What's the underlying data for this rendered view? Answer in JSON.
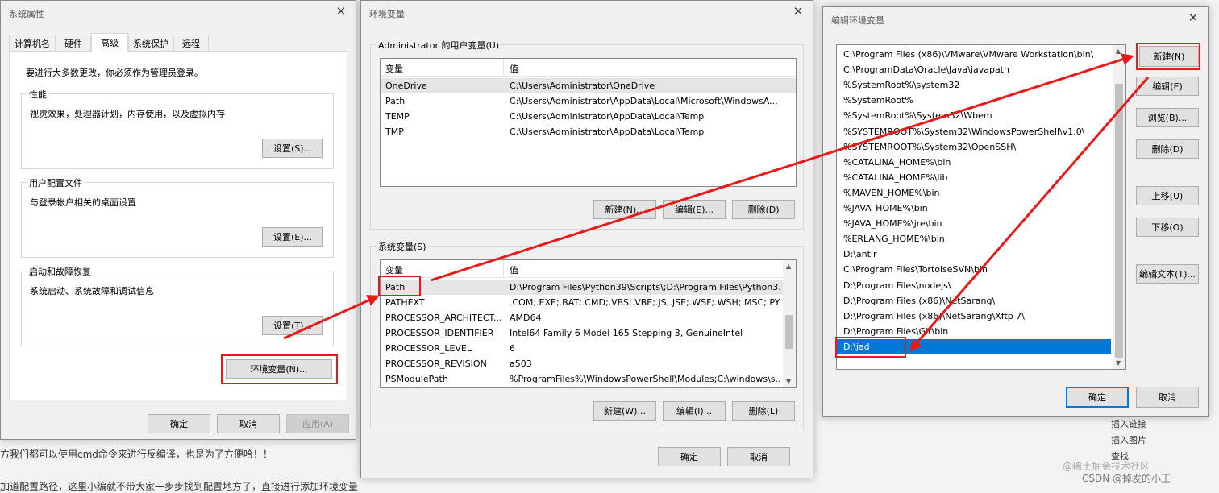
{
  "background": {
    "line1": "方我们都可以使用cmd命令来进行反编译，也是为了方便哈！！",
    "line2": "加道配置路径，这里小编就不带大家一步步找到配置地方了，直接进行添加环境变量",
    "right_panel": {
      "insert_link": "插入链接",
      "insert_image": "插入图片",
      "find": "查找"
    },
    "watermark": "CSDN @掉发的小王",
    "watermark2": "@稀土掘金技术社区"
  },
  "sysprops": {
    "title": "系统属性",
    "tabs": [
      "计算机名",
      "硬件",
      "高级",
      "系统保护",
      "远程"
    ],
    "active_tab": 2,
    "admin_note": "要进行大多数更改，你必须作为管理员登录。",
    "performance": {
      "label": "性能",
      "desc": "视觉效果，处理器计划，内存使用，以及虚拟内存",
      "button": "设置(S)..."
    },
    "profile": {
      "label": "用户配置文件",
      "desc": "与登录帐户相关的桌面设置",
      "button": "设置(E)..."
    },
    "startup": {
      "label": "启动和故障恢复",
      "desc": "系统启动、系统故障和调试信息",
      "button": "设置(T)..."
    },
    "env_button": "环境变量(N)...",
    "ok": "确定",
    "cancel": "取消",
    "apply": "应用(A)"
  },
  "envvars": {
    "title": "环境变量",
    "user_group": "Administrator 的用户变量(U)",
    "col_var": "变量",
    "col_val": "值",
    "user_rows": [
      {
        "name": "OneDrive",
        "value": "C:\\Users\\Administrator\\OneDrive"
      },
      {
        "name": "Path",
        "value": "C:\\Users\\Administrator\\AppData\\Local\\Microsoft\\WindowsA..."
      },
      {
        "name": "TEMP",
        "value": "C:\\Users\\Administrator\\AppData\\Local\\Temp"
      },
      {
        "name": "TMP",
        "value": "C:\\Users\\Administrator\\AppData\\Local\\Temp"
      }
    ],
    "user_buttons": {
      "new": "新建(N)...",
      "edit": "编辑(E)...",
      "delete": "删除(D)"
    },
    "sys_group": "系统变量(S)",
    "sys_rows": [
      {
        "name": "Path",
        "value": "D:\\Program Files\\Python39\\Scripts\\;D:\\Program Files\\Python3..."
      },
      {
        "name": "PATHEXT",
        "value": ".COM;.EXE;.BAT;.CMD;.VBS;.VBE;.JS;.JSE;.WSF;.WSH;.MSC;.PY;.P..."
      },
      {
        "name": "PROCESSOR_ARCHITECT...",
        "value": "AMD64"
      },
      {
        "name": "PROCESSOR_IDENTIFIER",
        "value": "Intel64 Family 6 Model 165 Stepping 3, GenuineIntel"
      },
      {
        "name": "PROCESSOR_LEVEL",
        "value": "6"
      },
      {
        "name": "PROCESSOR_REVISION",
        "value": "a503"
      },
      {
        "name": "PSModulePath",
        "value": "%ProgramFiles%\\WindowsPowerShell\\Modules;C:\\windows\\s..."
      }
    ],
    "sys_buttons": {
      "new": "新建(W)...",
      "edit": "编辑(I)...",
      "delete": "删除(L)"
    },
    "ok": "确定",
    "cancel": "取消"
  },
  "editenv": {
    "title": "编辑环境变量",
    "items": [
      "C:\\Program Files (x86)\\VMware\\VMware Workstation\\bin\\",
      "C:\\ProgramData\\Oracle\\Java\\javapath",
      "%SystemRoot%\\system32",
      "%SystemRoot%",
      "%SystemRoot%\\System32\\Wbem",
      "%SYSTEMROOT%\\System32\\WindowsPowerShell\\v1.0\\",
      "%SYSTEMROOT%\\System32\\OpenSSH\\",
      "%CATALINA_HOME%\\bin",
      "%CATALINA_HOME%\\lib",
      "%MAVEN_HOME%\\bin",
      "%JAVA_HOME%\\bin",
      "%JAVA_HOME%\\jre\\bin",
      "%ERLANG_HOME%\\bin",
      "D:\\antlr",
      "C:\\Program Files\\TortoiseSVN\\bin",
      "D:\\Program Files\\nodejs\\",
      "D:\\Program Files (x86)\\NetSarang\\",
      "D:\\Program Files (x86)\\NetSarang\\Xftp 7\\",
      "D:\\Program Files\\Git\\bin",
      "D:\\jad"
    ],
    "selected_index": 19,
    "buttons": {
      "new": "新建(N)",
      "edit": "编辑(E)",
      "browse": "浏览(B)...",
      "delete": "删除(D)",
      "up": "上移(U)",
      "down": "下移(O)",
      "edit_text": "编辑文本(T)..."
    },
    "ok": "确定",
    "cancel": "取消"
  },
  "colors": {
    "annotation_red": "#e81919",
    "selection_blue": "#0078d7"
  }
}
